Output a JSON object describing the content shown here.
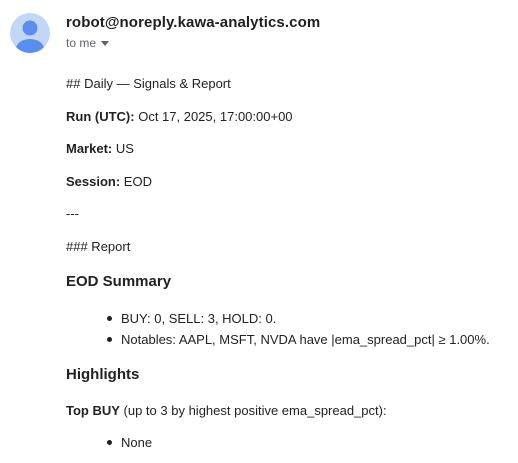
{
  "email": {
    "sender": "robot@noreply.kawa-analytics.com",
    "recipient_label": "to me",
    "body": {
      "heading_line": "## Daily — Signals & Report",
      "run_label": "Run (UTC):",
      "run_value": " Oct 17, 2025, 17:00:00+00",
      "market_label": "Market:",
      "market_value": " US",
      "session_label": "Session:",
      "session_value": " EOD",
      "separator": "---",
      "report_heading": "### Report",
      "eod_summary_title": "EOD Summary",
      "eod_summary_items": [
        "BUY: 0, SELL: 3, HOLD: 0.",
        "Notables: AAPL, MSFT, NVDA have |ema_spread_pct| ≥ 1.00%."
      ],
      "highlights_title": "Highlights",
      "top_buy_label": "Top BUY",
      "top_buy_rest": " (up to 3 by highest positive ema_spread_pct):",
      "top_buy_items": [
        "None"
      ]
    }
  },
  "colors": {
    "avatar_bg": "#c2d7f5",
    "avatar_figure": "#5b8def",
    "text": "#222222",
    "muted": "#5f6368"
  },
  "icons": {
    "avatar": "person-silhouette-icon",
    "expand": "caret-down-icon"
  }
}
